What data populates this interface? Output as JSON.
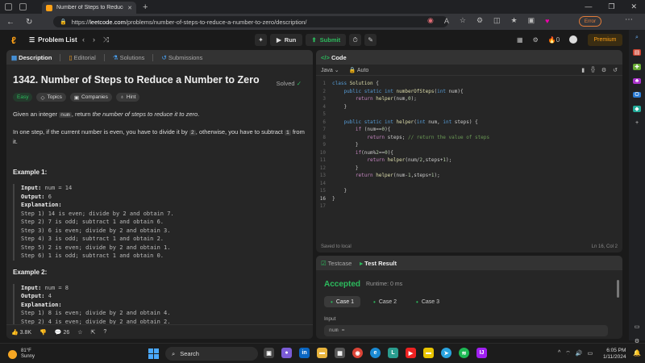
{
  "browser": {
    "tab_title": "Number of Steps to Reduce a N...",
    "tab_close": "✕",
    "new_tab": "+",
    "url_prefix": "https://",
    "url_host": "leetcode.com",
    "url_path": "/problems/number-of-steps-to-reduce-a-number-to-zero/description/",
    "error_label": "Error"
  },
  "header": {
    "problem_list": "Problem List",
    "run": "Run",
    "submit": "Submit",
    "notifications": "0",
    "premium": "Premium"
  },
  "left_tabs": [
    "Description",
    "Editorial",
    "Solutions",
    "Submissions"
  ],
  "problem": {
    "title": "1342. Number of Steps to Reduce a Number to Zero",
    "solved": "Solved",
    "tags": [
      "Easy",
      "Topics",
      "Companies",
      "Hint"
    ],
    "statement_pre": "Given an integer ",
    "statement_code": "num",
    "statement_mid": ", return ",
    "statement_em": "the number of steps to reduce it to zero",
    "statement_post": ".",
    "rule_pre": "In one step, if the current number is even, you have to divide it by ",
    "rule_code1": "2",
    "rule_mid": ", otherwise, you have to subtract ",
    "rule_code2": "1",
    "rule_post": " from it.",
    "example1": {
      "heading": "Example 1:",
      "input_label": "Input:",
      "input": "num = 14",
      "output_label": "Output:",
      "output": "6",
      "explanation_label": "Explanation:",
      "steps": [
        "Step 1) 14 is even; divide by 2 and obtain 7.",
        "Step 2) 7 is odd; subtract 1 and obtain 6.",
        "Step 3) 6 is even; divide by 2 and obtain 3.",
        "Step 4) 3 is odd; subtract 1 and obtain 2.",
        "Step 5) 2 is even; divide by 2 and obtain 1.",
        "Step 6) 1 is odd; subtract 1 and obtain 0."
      ]
    },
    "example2": {
      "heading": "Example 2:",
      "input_label": "Input:",
      "input": "num = 8",
      "output_label": "Output:",
      "output": "4",
      "explanation_label": "Explanation:",
      "steps": [
        "Step 1) 8 is even; divide by 2 and obtain 4.",
        "Step 2) 4 is even; divide by 2 and obtain 2."
      ]
    },
    "likes": "3.8K",
    "comments": "26"
  },
  "code": {
    "tab": "Code",
    "language": "Java",
    "auto": "Auto",
    "saved": "Saved to local",
    "cursor": "Ln 16, Col 2",
    "line_numbers": [
      "1",
      "2",
      "3",
      "4",
      "5",
      "6",
      "7",
      "8",
      "9",
      "10",
      "11",
      "12",
      "13",
      "14",
      "15",
      "16",
      "17"
    ]
  },
  "test": {
    "tabs": [
      "Testcase",
      "Test Result"
    ],
    "status": "Accepted",
    "runtime": "Runtime: 0 ms",
    "cases": [
      "Case 1",
      "Case 2",
      "Case 3"
    ],
    "input_label": "Input",
    "input_value": "num ="
  },
  "taskbar": {
    "temp": "81°F",
    "weather": "Sunny",
    "search": "Search",
    "time": "6:05 PM",
    "date": "1/11/2024"
  }
}
